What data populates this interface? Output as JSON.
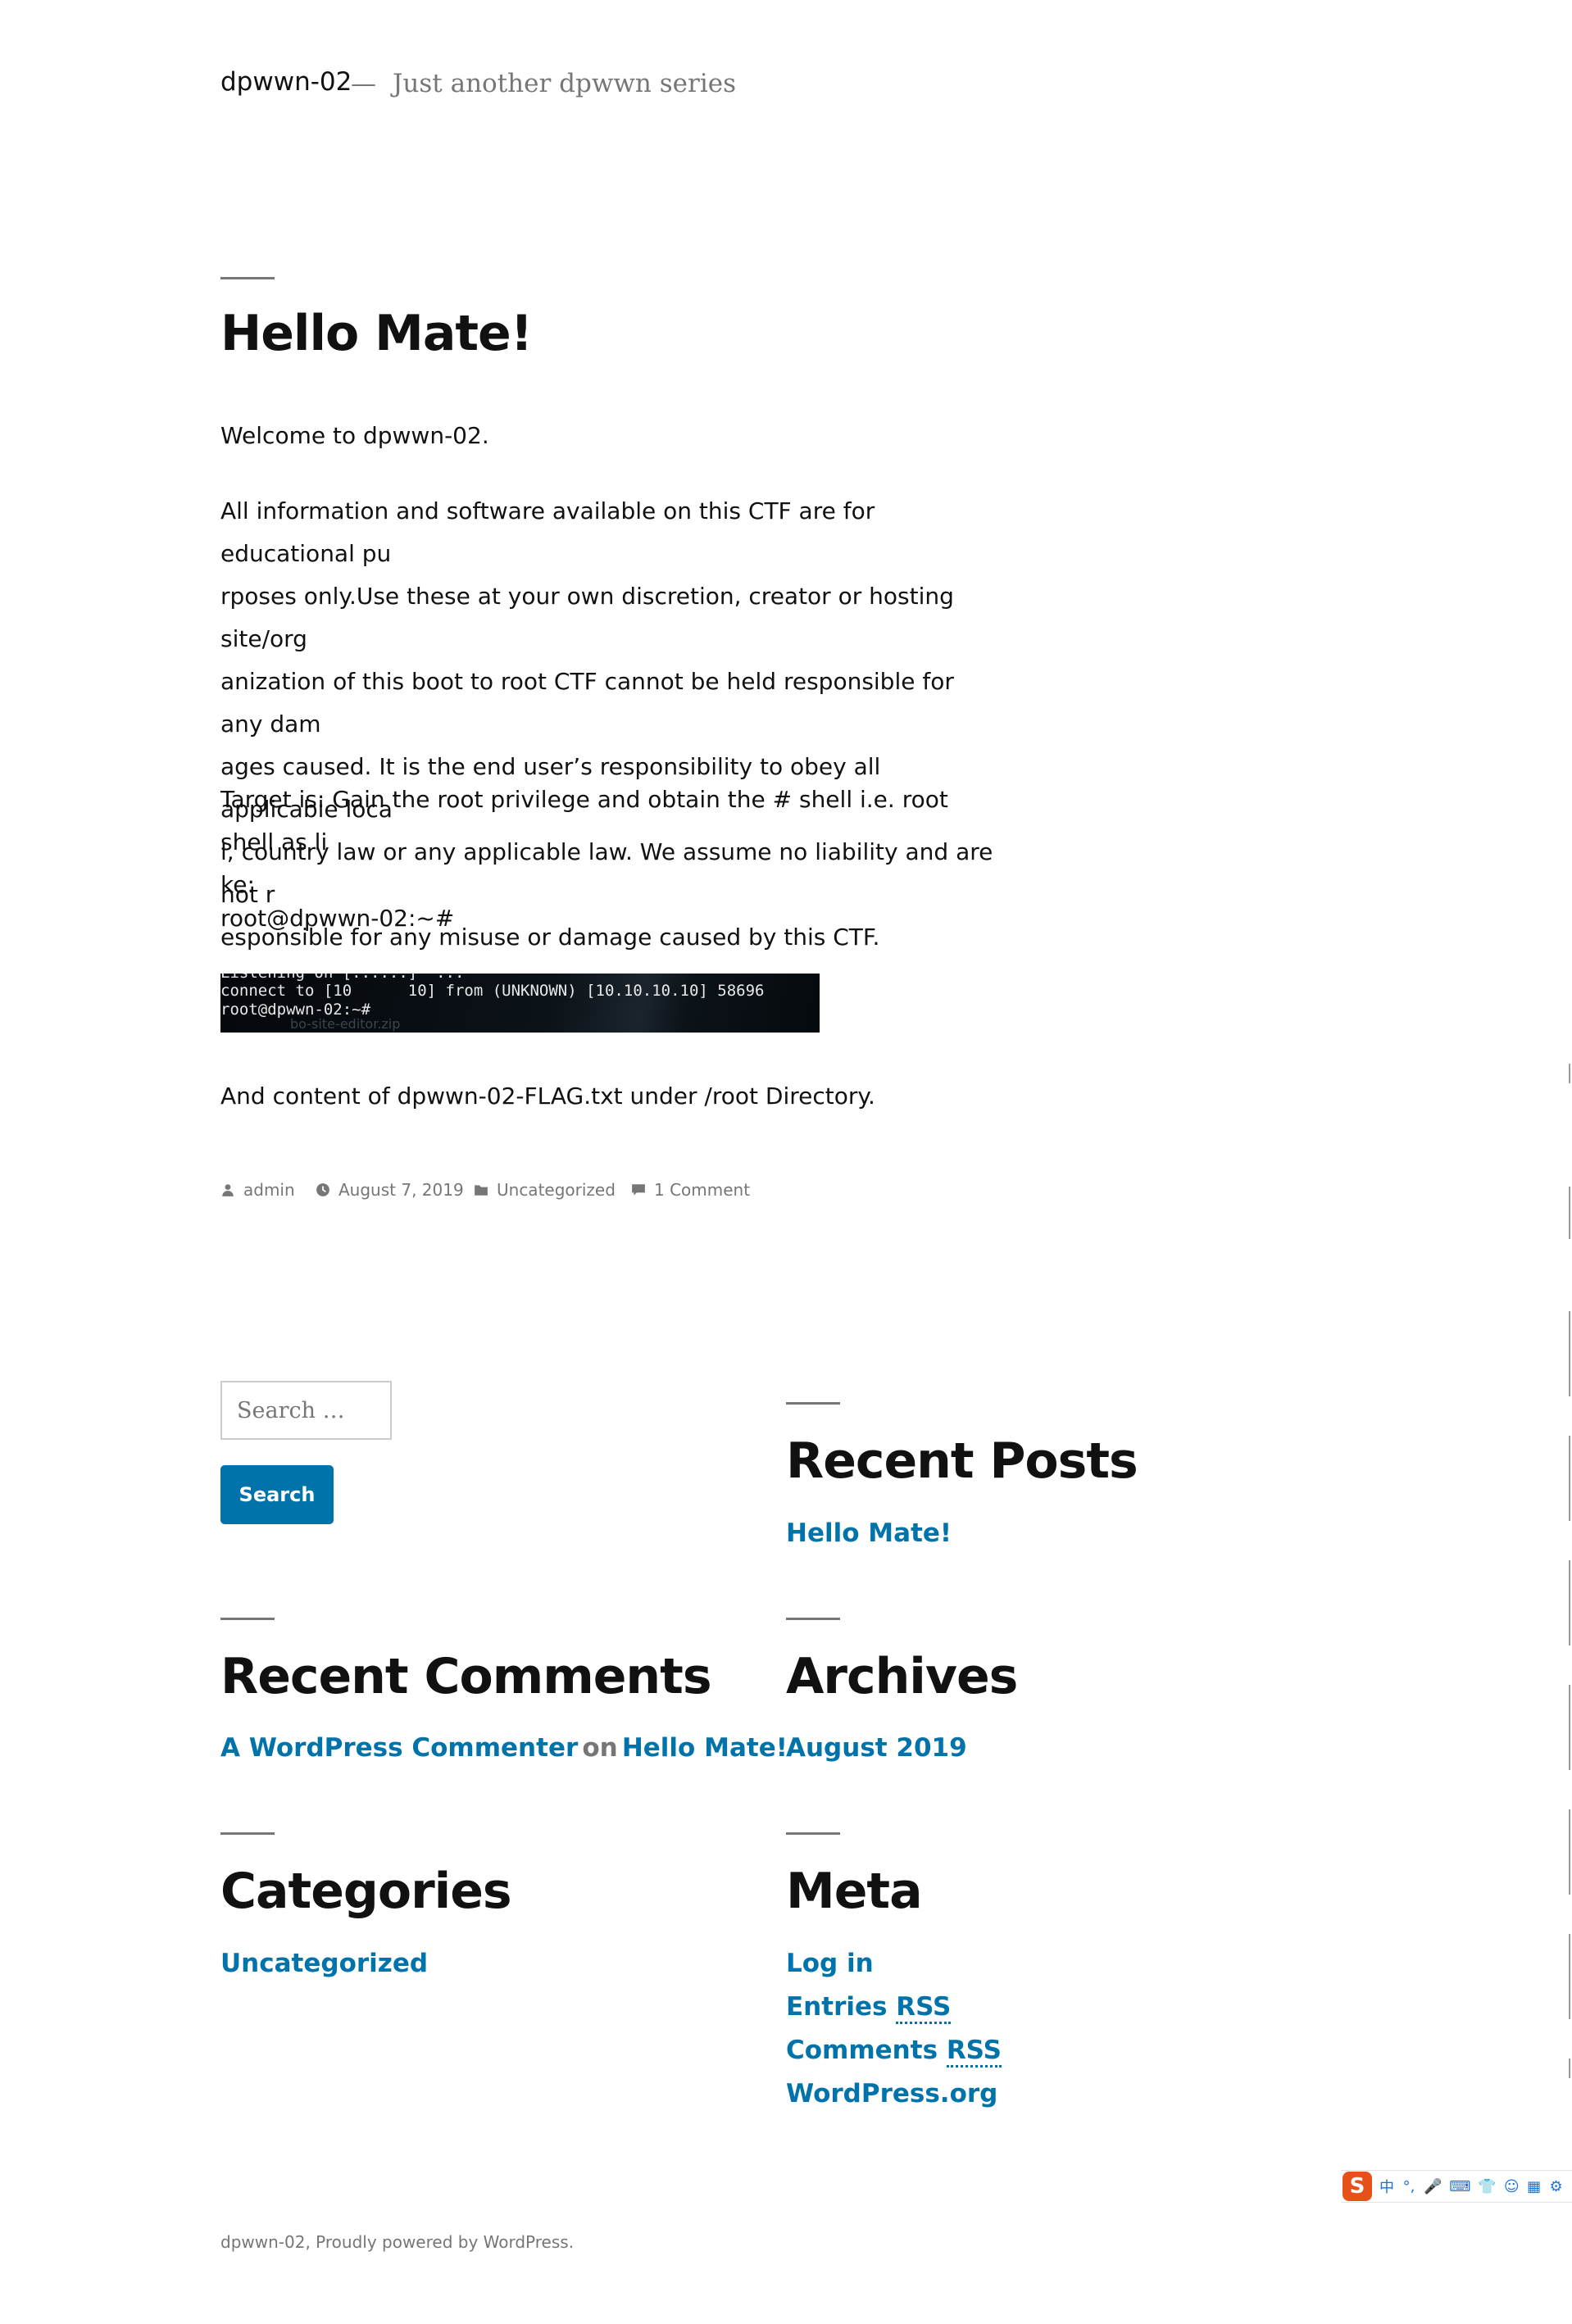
{
  "header": {
    "site_title": "dpwwn-02",
    "separator": "—",
    "tagline": "Just another dpwwn series"
  },
  "post": {
    "title": "Hello Mate!",
    "paragraphs": [
      "Welcome to dpwwn-02.",
      "All information and software available on this CTF are for educational pu\nrposes only.Use these at your own discretion, creator or hosting site/org\nanization of this boot to root CTF cannot be held responsible for any dam\nages caused. It is the end user’s responsibility to obey all applicable loca\nl, country law or any applicable law. We assume no liability and are not r\nesponsible for any misuse or damage caused by this CTF.",
      "Target is: Gain the root privilege and obtain the # shell i.e. root shell as li\nke:",
      "root@dpwwn-02:~#",
      "And content of dpwwn-02-FLAG.txt under /root Directory."
    ],
    "terminal": {
      "line0": "Listening on [......]  ...",
      "line1": "connect to [10      10] from (UNKNOWN) [10.10.10.10] 58696",
      "line2": "root@dpwwn-02:~#",
      "faded": "bo-site-editor.zip"
    },
    "meta": {
      "author": "admin",
      "date": "August 7, 2019",
      "category": "Uncategorized",
      "comments": "1 Comment"
    }
  },
  "sidebar": {
    "search": {
      "placeholder": "Search …",
      "button": "Search"
    },
    "recent_posts": {
      "title": "Recent Posts",
      "items": [
        "Hello Mate!"
      ]
    },
    "recent_comments": {
      "title": "Recent Comments",
      "author": "A WordPress Commenter",
      "on": "on",
      "post": "Hello Mate!"
    },
    "archives": {
      "title": "Archives",
      "items": [
        "August 2019"
      ]
    },
    "categories": {
      "title": "Categories",
      "items": [
        "Uncategorized"
      ]
    },
    "meta": {
      "title": "Meta",
      "log_in": "Log in",
      "entries_prefix": "Entries ",
      "entries_rss": "RSS",
      "comments_prefix": "Comments ",
      "comments_rss": "RSS",
      "wordpress": "WordPress.org"
    }
  },
  "footer": {
    "site": "dpwwn-02,",
    "powered": "Proudly powered by WordPress."
  },
  "ime_toolbar": {
    "logo": "S",
    "items": [
      "中",
      "°,",
      "🎤",
      "⌨",
      "👕",
      "☺",
      "▦",
      "⚙"
    ],
    "brand_color": "#e8501a",
    "icon_color": "#1a73d9"
  },
  "colors": {
    "link": "#0073aa",
    "muted": "#767676",
    "text": "#111111"
  }
}
